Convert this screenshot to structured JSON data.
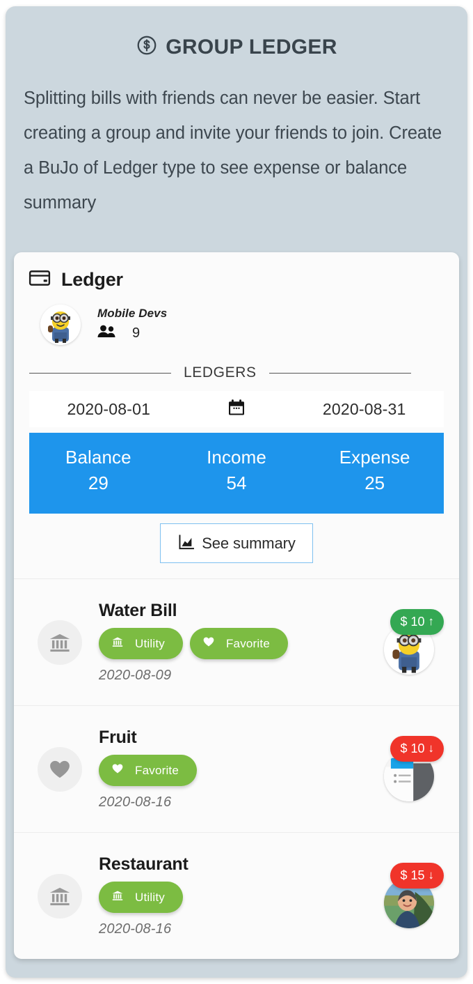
{
  "intro": {
    "icon": "dollar-coin-icon",
    "title": "GROUP LEDGER",
    "body": "Splitting bills with friends can never be easier. Start creating a group and invite your friends to join. Create a BuJo of Ledger type to see expense or balance summary"
  },
  "card": {
    "icon": "credit-card-icon",
    "title": "Ledger",
    "group": {
      "avatar": "minion-avatar",
      "name": "Mobile Devs",
      "members_icon": "people-icon",
      "members_count": "9"
    },
    "section_label": "LEDGERS",
    "date_range": {
      "start": "2020-08-01",
      "icon": "calendar-icon",
      "end": "2020-08-31"
    },
    "totals": [
      {
        "label": "Balance",
        "value": "29"
      },
      {
        "label": "Income",
        "value": "54"
      },
      {
        "label": "Expense",
        "value": "25"
      }
    ],
    "summary_button": {
      "icon": "bar-chart-icon",
      "label": "See summary"
    },
    "entries": [
      {
        "icon": "bank-icon",
        "name": "Water Bill",
        "chips": [
          {
            "icon": "bank-icon",
            "label": "Utility"
          },
          {
            "icon": "heart-icon",
            "label": "Favorite"
          }
        ],
        "date": "2020-08-09",
        "avatar": "minion-avatar",
        "amount": "$ 10",
        "direction": "up",
        "direction_glyph": "↑",
        "kind": "income"
      },
      {
        "icon": "heart-icon",
        "name": "Fruit",
        "chips": [
          {
            "icon": "heart-icon",
            "label": "Favorite"
          }
        ],
        "date": "2020-08-16",
        "avatar": "screenshot-avatar",
        "amount": "$ 10",
        "direction": "down",
        "direction_glyph": "↓",
        "kind": "expense"
      },
      {
        "icon": "bank-icon",
        "name": "Restaurant",
        "chips": [
          {
            "icon": "bank-icon",
            "label": "Utility"
          }
        ],
        "date": "2020-08-16",
        "avatar": "photo-avatar",
        "amount": "$ 15",
        "direction": "down",
        "direction_glyph": "↓",
        "kind": "expense"
      }
    ]
  },
  "colors": {
    "page_background": "#ccd7de",
    "card_background": "#fbfbfb",
    "accent_blue": "#1e95ec",
    "chip_green": "#7cbc42",
    "badge_income_green": "#34a853",
    "badge_expense_red": "#f0342a",
    "title_text": "#39444c"
  }
}
